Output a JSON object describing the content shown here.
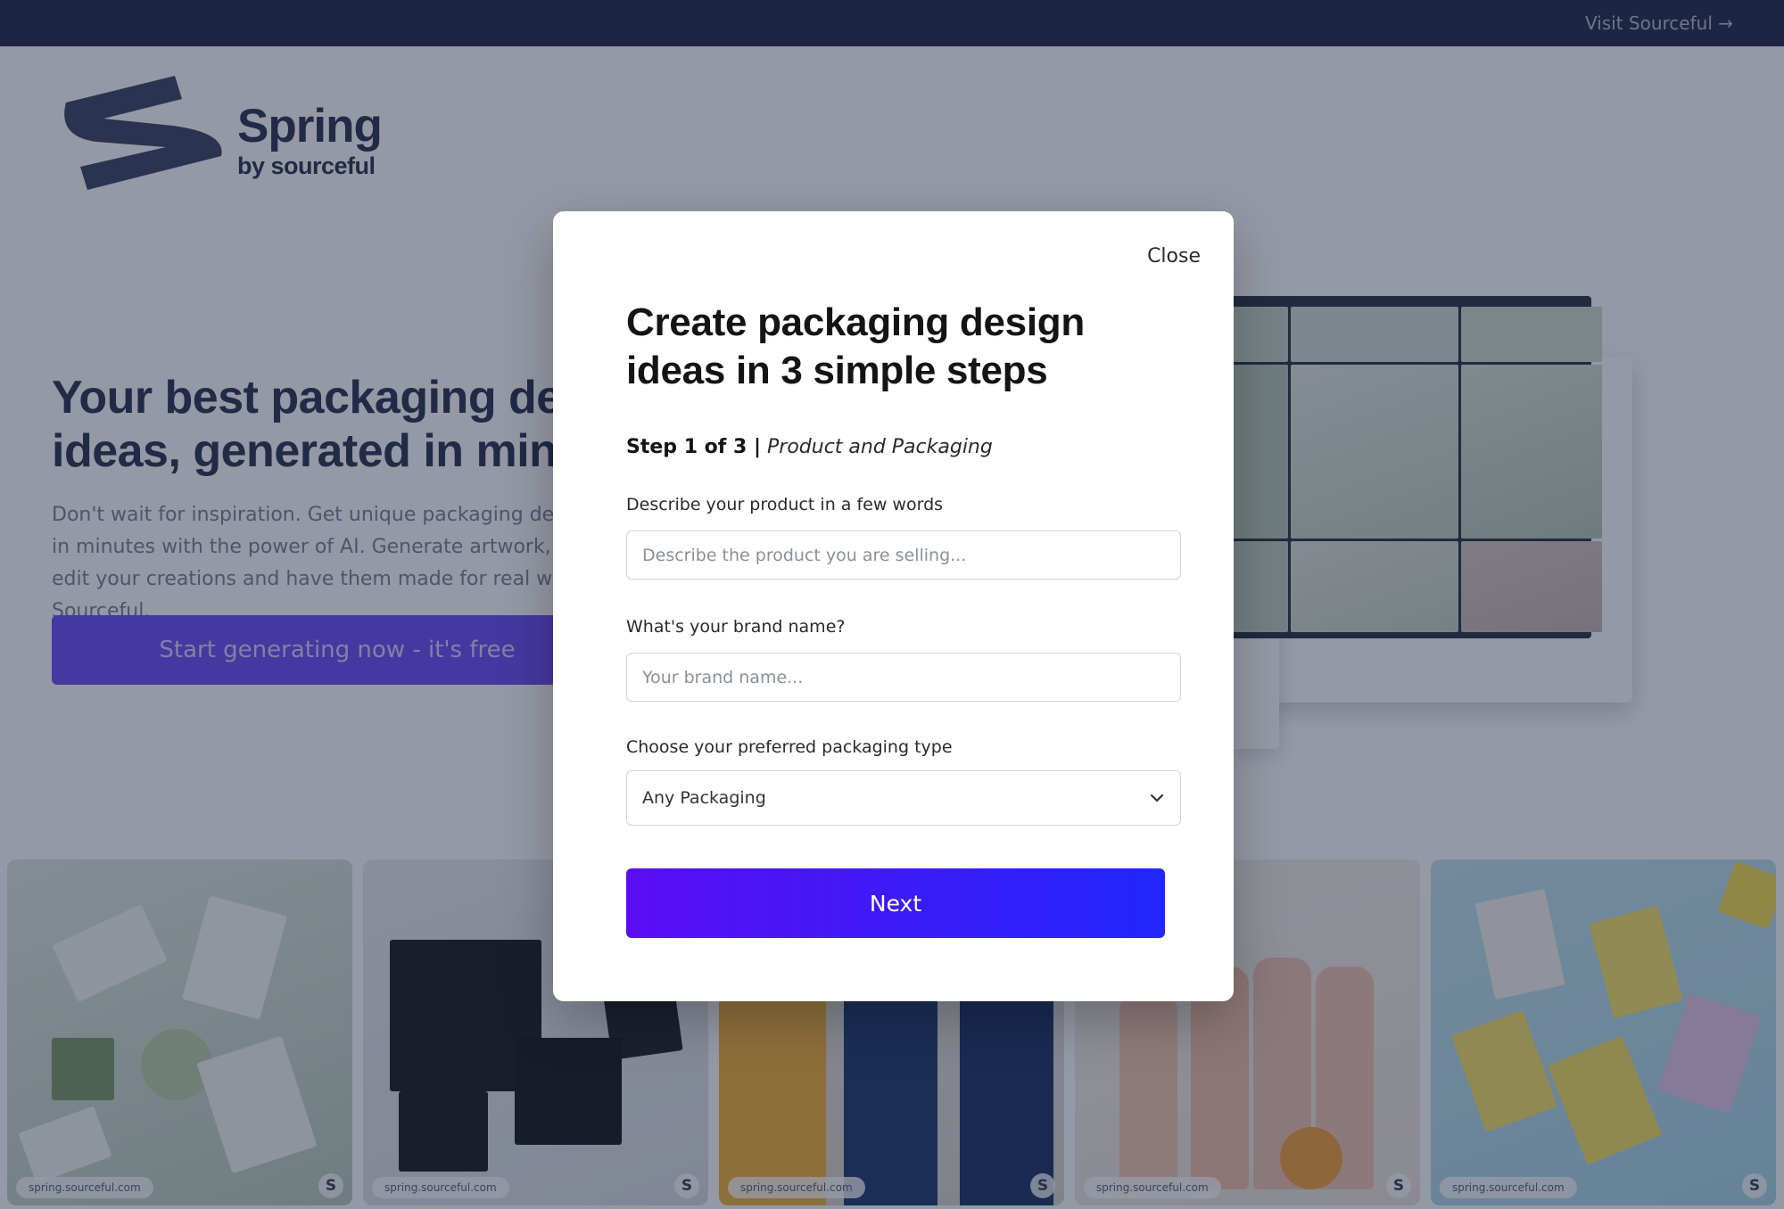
{
  "topbar": {
    "visit_link": "Visit Sourceful →"
  },
  "logo": {
    "brand": "Spring",
    "tagline": "by sourceful"
  },
  "hero": {
    "title": "Your best packaging design ideas, generated in minutes",
    "description": "Don't wait for inspiration. Get unique packaging design ideas in minutes with the power of AI. Generate artwork, style and edit your creations and have them made for real with Sourceful.",
    "cta": "Start generating now - it's free"
  },
  "tiles": [
    {
      "watermark": "spring.sourceful.com",
      "badge": "S"
    },
    {
      "watermark": "spring.sourceful.com",
      "badge": "S"
    },
    {
      "watermark": "spring.sourceful.com",
      "badge": "S"
    },
    {
      "watermark": "spring.sourceful.com",
      "badge": "S"
    },
    {
      "watermark": "spring.sourceful.com",
      "badge": "S"
    }
  ],
  "modal": {
    "close": "Close",
    "title": "Create packaging design ideas in 3 simple steps",
    "step_prefix": "Step 1 of 3 |",
    "step_name": "Product and Packaging",
    "product_label": "Describe your product in a few words",
    "product_placeholder": "Describe the product you are selling...",
    "brand_label": "What's your brand name?",
    "brand_placeholder": "Your brand name...",
    "packaging_label": "Choose your preferred packaging type",
    "packaging_value": "Any Packaging",
    "next": "Next"
  },
  "colors": {
    "accent_gradient_start": "#5b0df5",
    "accent_gradient_end": "#2126fb",
    "hero_cta": "#6e4cf6",
    "topbar": "#202c4a"
  }
}
